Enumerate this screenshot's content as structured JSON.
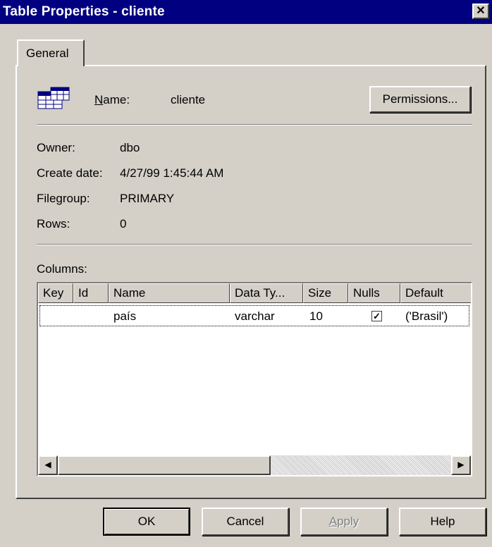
{
  "window": {
    "title": "Table Properties - cliente",
    "close_glyph": "✕"
  },
  "tabs": [
    {
      "label": "General"
    }
  ],
  "general": {
    "icon": "table-icon",
    "name_label_accel": "N",
    "name_label_rest": "ame:",
    "name_value": "cliente",
    "permissions_label": "Permissions...",
    "owner_label": "Owner:",
    "owner_value": "dbo",
    "create_date_label": "Create date:",
    "create_date_value": "4/27/99 1:45:44 AM",
    "filegroup_label": "Filegroup:",
    "filegroup_value": "PRIMARY",
    "rows_label": "Rows:",
    "rows_value": "0",
    "columns_label": "Columns:"
  },
  "columns_table": {
    "headers": [
      "Key",
      "Id",
      "Name",
      "Data Ty...",
      "Size",
      "Nulls",
      "Default"
    ],
    "rows": [
      {
        "key": "",
        "id": "",
        "name": "país",
        "data_type": "varchar",
        "size": "10",
        "nulls": true,
        "default": "('Brasil')"
      }
    ]
  },
  "scrollbar": {
    "left_arrow": "◀",
    "right_arrow": "▶"
  },
  "buttons": {
    "ok": "OK",
    "cancel": "Cancel",
    "apply_accel": "A",
    "apply_rest": "pply",
    "help": "Help"
  },
  "check_glyph": "✓"
}
